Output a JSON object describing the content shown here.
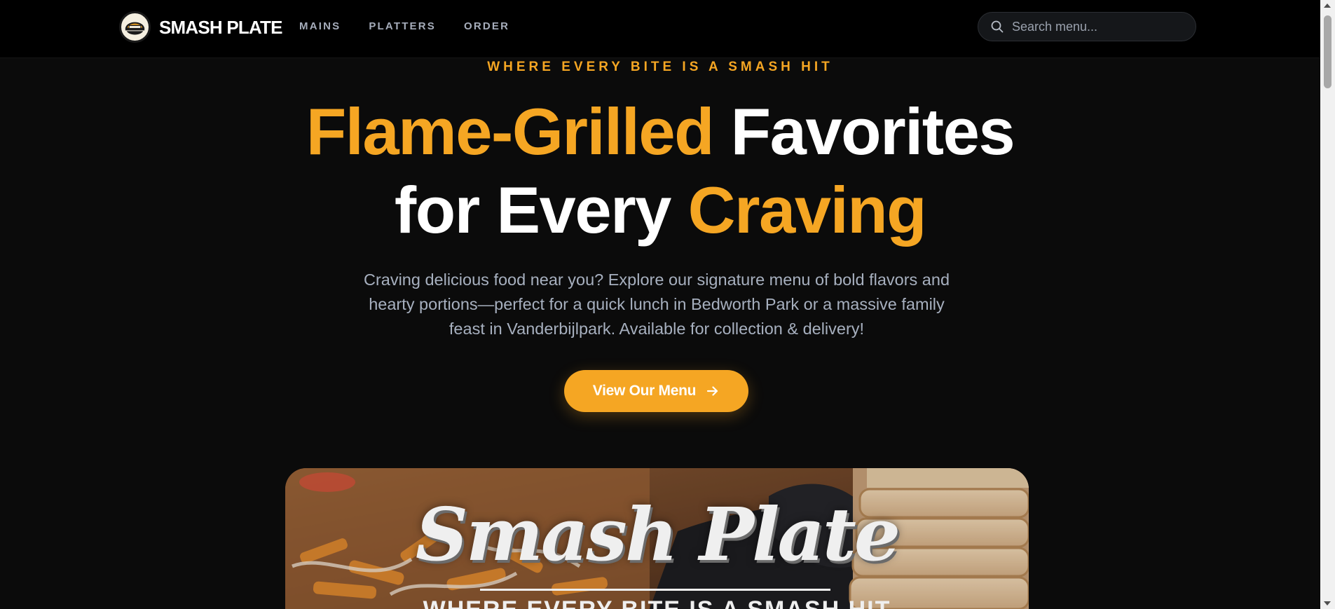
{
  "nav": {
    "brand": "SMASH PLATE",
    "logo_icon": "smash-plate-logo-badge",
    "links": [
      {
        "label": "MAINS"
      },
      {
        "label": "PLATTERS"
      },
      {
        "label": "ORDER"
      }
    ],
    "search": {
      "placeholder": "Search menu...",
      "value": "",
      "icon": "search-icon"
    }
  },
  "hero": {
    "tagline": "WHERE EVERY BITE IS A SMASH HIT",
    "headline": {
      "line1_accent": "Flame-Grilled",
      "line1_rest": " Favorites",
      "line2_lead": "for Every ",
      "line2_accent": "Craving"
    },
    "description": "Craving delicious food near you? Explore our signature menu of bold flavors and hearty portions—perfect for a quick lunch in Bedworth Park or a massive family feast in Vanderbijlpark. Available for collection & delivery!",
    "cta": {
      "label": "View Our Menu",
      "icon": "arrow-right-icon"
    }
  },
  "banner": {
    "title": "Smash Plate",
    "subtitle": "WHERE EVERY BITE IS A SMASH HIT"
  },
  "colors": {
    "accent": "#f5a623",
    "background": "#0b0b0b",
    "nav_background": "#000000",
    "muted_text": "#a7b0bf"
  }
}
